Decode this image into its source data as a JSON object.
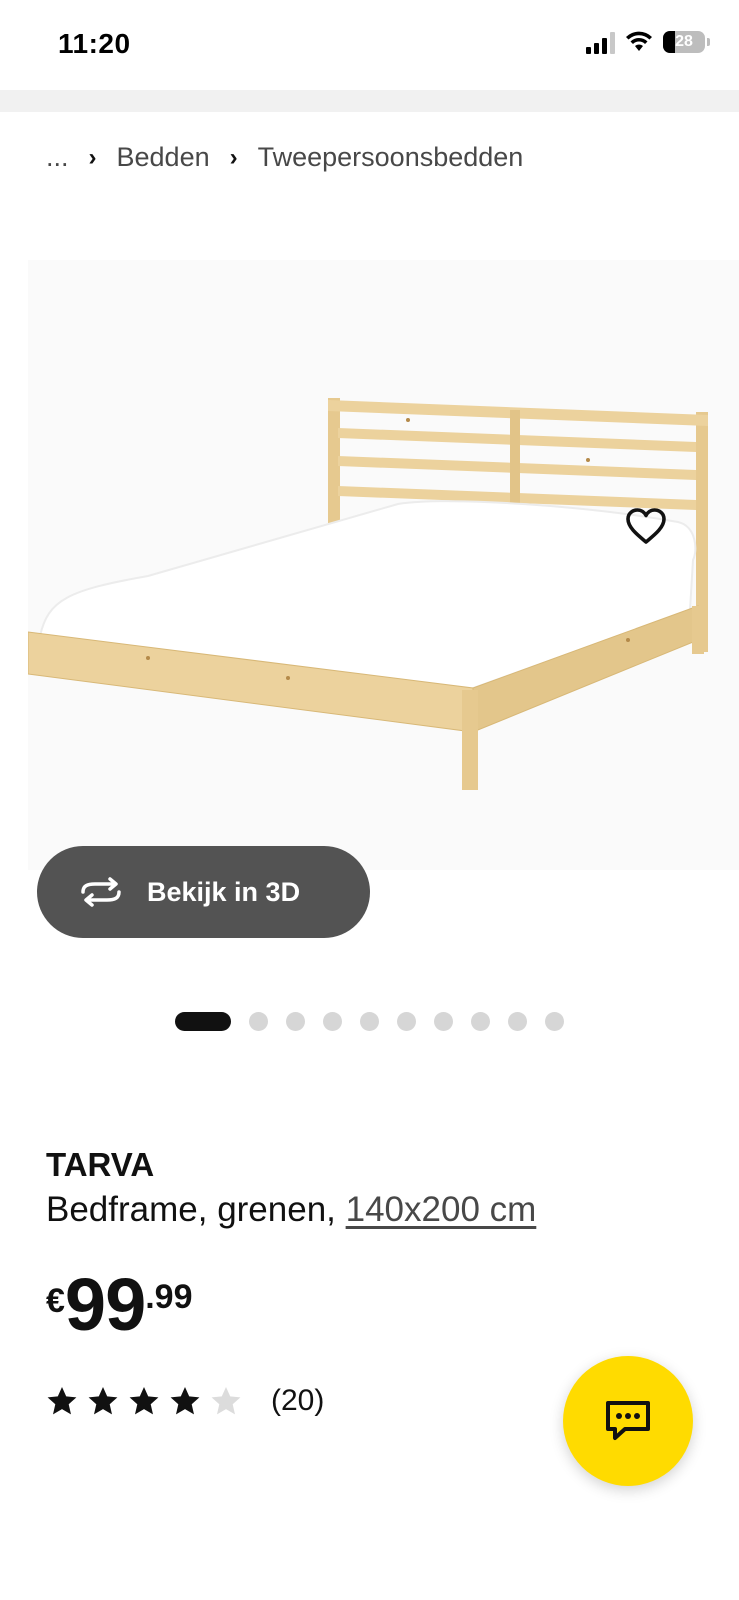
{
  "status_bar": {
    "time": "11:20",
    "battery": "28",
    "battery_level_percent": 28,
    "icons": [
      "signal-icon",
      "wifi-icon",
      "battery-icon"
    ]
  },
  "breadcrumb": {
    "ellipsis": "...",
    "items": [
      "Bedden",
      "Tweepersoonsbedden"
    ]
  },
  "gallery": {
    "image_subject": "product-photo-bed-frame",
    "view_3d_label": "Bekijk in 3D",
    "total_images": 10,
    "active_image": 1
  },
  "product": {
    "name": "TARVA",
    "description": "Bedframe, grenen, ",
    "size_link": "140x200 cm",
    "price_currency": "€",
    "price_integer": "99",
    "price_decimal": ".99",
    "rating_value": 4,
    "rating_max": 5,
    "review_count": "(20)"
  },
  "colors": {
    "accent_yellow": "#ffdb00",
    "button_dark": "#535353",
    "text": "#111111",
    "wood": "#e9cf96"
  }
}
